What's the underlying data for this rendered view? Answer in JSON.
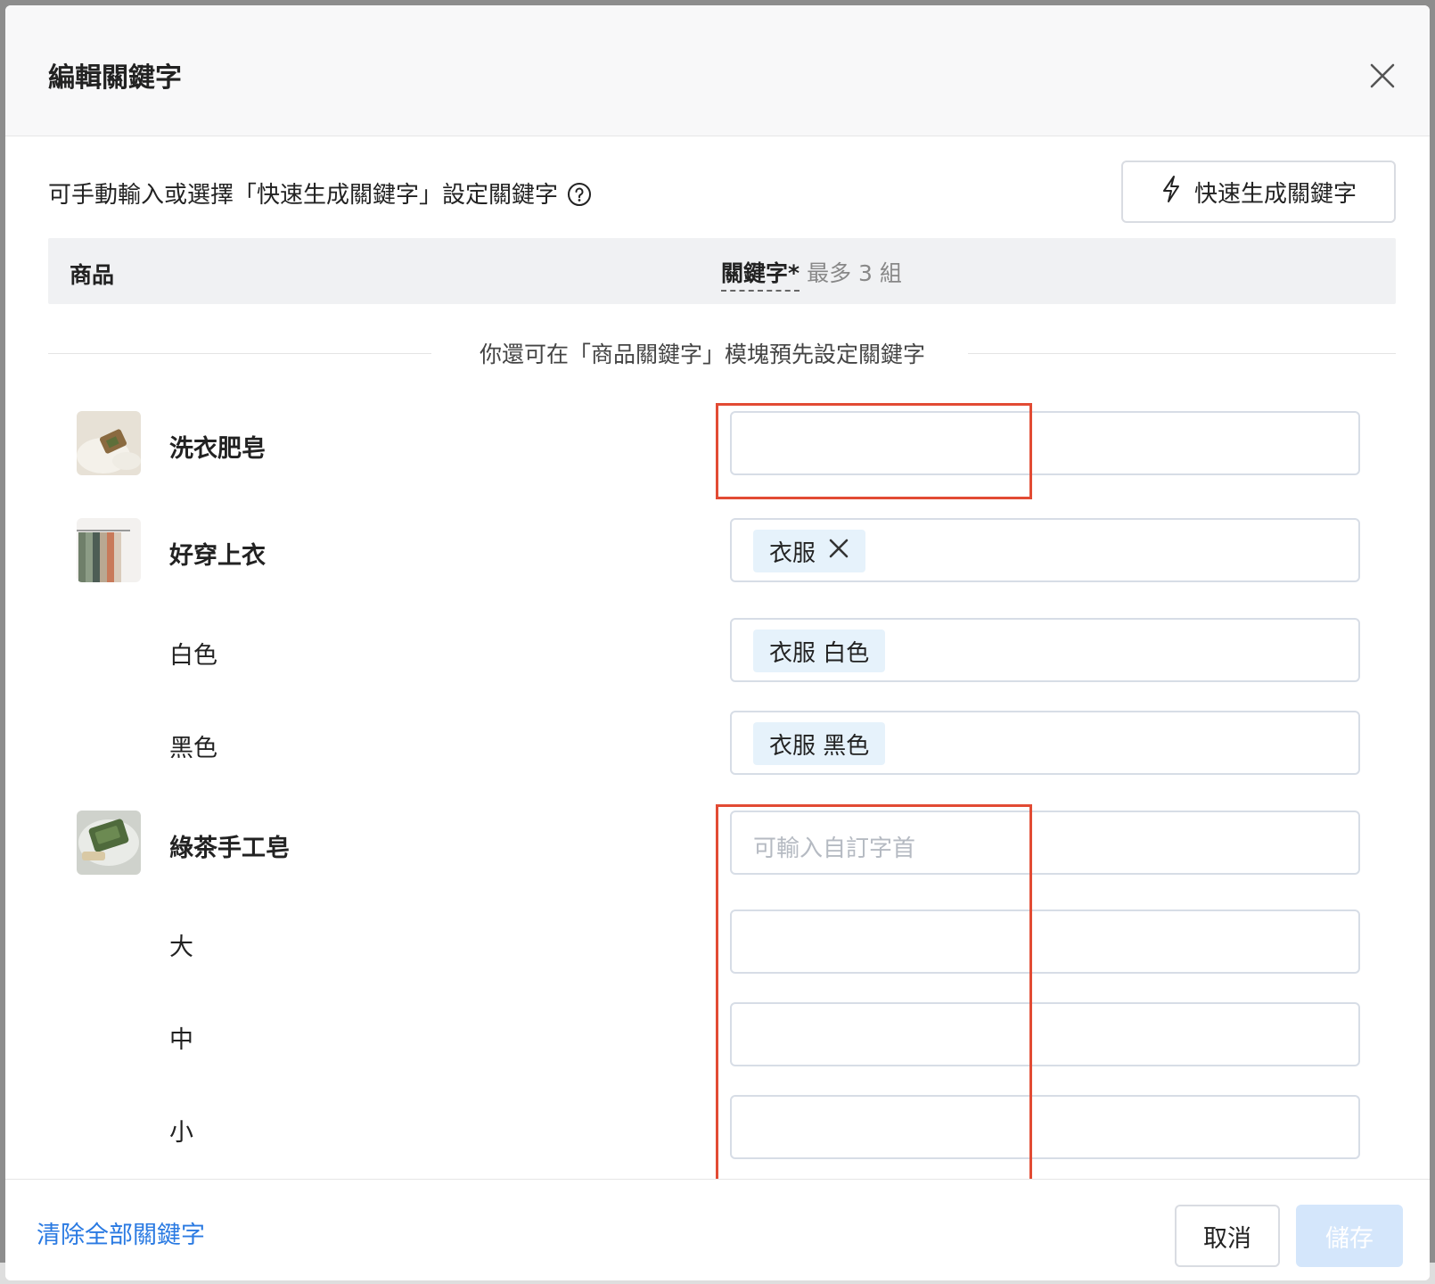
{
  "modal": {
    "title": "編輯關鍵字",
    "hint": "可手動輸入或選擇「快速生成關鍵字」設定關鍵字",
    "quick_generate_label": "快速生成關鍵字"
  },
  "table": {
    "col_product": "商品",
    "col_keyword": "關鍵字*",
    "col_keyword_note": "最多 3 組",
    "module_hint": "你還可在「商品關鍵字」模塊預先設定關鍵字"
  },
  "rows": [
    {
      "label": "洗衣肥皂",
      "thumb": "soap-photo",
      "keywords": [],
      "placeholder": ""
    },
    {
      "label": "好穿上衣",
      "thumb": "shirts-photo",
      "keywords": [
        "衣服"
      ],
      "placeholder": ""
    },
    {
      "label": "白色",
      "keywords": [
        "衣服 白色"
      ],
      "placeholder": ""
    },
    {
      "label": "黑色",
      "keywords": [
        "衣服 黑色"
      ],
      "placeholder": ""
    },
    {
      "label": "綠茶手工皂",
      "thumb": "green-tea-soap-photo",
      "keywords": [],
      "placeholder": "可輸入自訂字首"
    },
    {
      "label": "大",
      "keywords": [],
      "placeholder": ""
    },
    {
      "label": "中",
      "keywords": [],
      "placeholder": ""
    },
    {
      "label": "小",
      "keywords": [],
      "placeholder": ""
    }
  ],
  "footer": {
    "clear_all_label": "清除全部關鍵字",
    "cancel_label": "取消",
    "save_label": "儲存"
  },
  "colors": {
    "accent": "#2a7ae2",
    "tag_bg": "#e6f2fb",
    "highlight_box": "#e24b34",
    "save_disabled": "#d4e6fb"
  }
}
